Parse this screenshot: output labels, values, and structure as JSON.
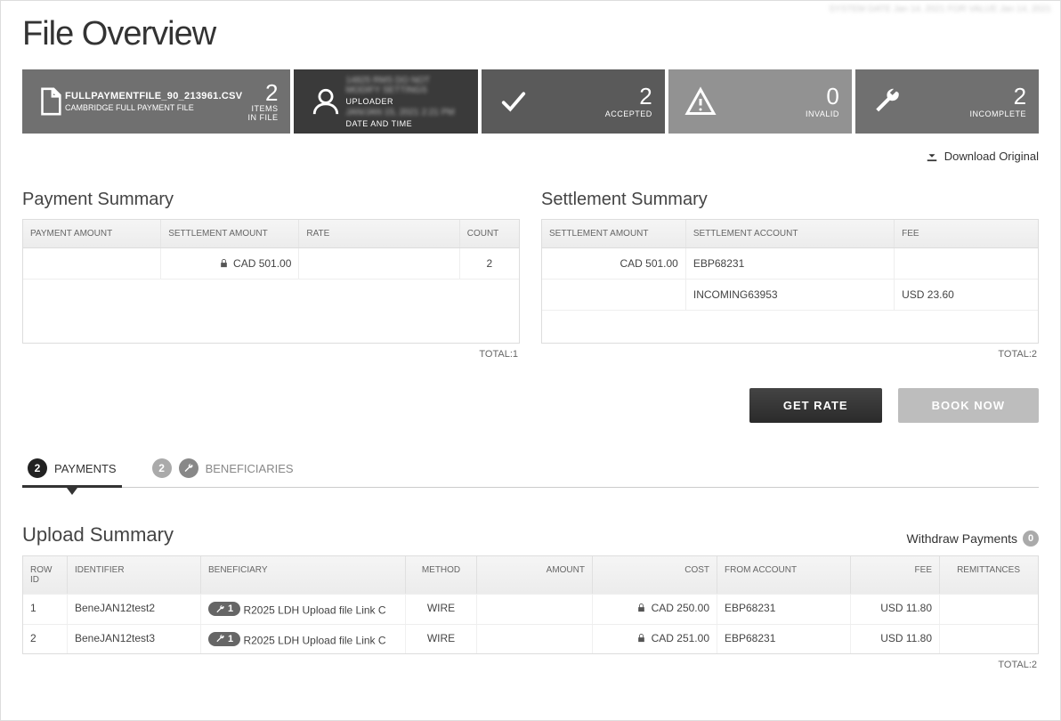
{
  "top_blur": "SYSTEM DATE Jan 14, 2021 FOR VALUE Jan 14, 2021",
  "title": "File Overview",
  "cards": {
    "file": {
      "name": "FULLPAYMENTFILE_90_213961.CSV",
      "desc": "CAMBRIDGE FULL PAYMENT FILE",
      "count": "2",
      "count_label": "ITEMS IN FILE"
    },
    "upload": {
      "line1_blur": "14825 RMS DO NOT MODIFY SETTINGS",
      "uploader_label": "UPLOADER",
      "line2_blur": "JAN/JAN 15, 2021 2:21 PM",
      "datetime_label": "DATE AND TIME"
    },
    "accepted": {
      "count": "2",
      "label": "ACCEPTED"
    },
    "invalid": {
      "count": "0",
      "label": "INVALID"
    },
    "incomplete": {
      "count": "2",
      "label": "INCOMPLETE"
    }
  },
  "download_label": "Download Original",
  "payment_summary": {
    "title": "Payment Summary",
    "headers": {
      "c1": "PAYMENT AMOUNT",
      "c2": "SETTLEMENT AMOUNT",
      "c3": "RATE",
      "c4": "COUNT"
    },
    "rows": [
      {
        "c1": "",
        "c2": "CAD 501.00",
        "c2_locked": true,
        "c3": "",
        "c4": "2"
      }
    ],
    "total_label": "TOTAL:1"
  },
  "settlement_summary": {
    "title": "Settlement Summary",
    "headers": {
      "c1": "SETTLEMENT AMOUNT",
      "c2": "SETTLEMENT ACCOUNT",
      "c3": "FEE"
    },
    "rows": [
      {
        "c1": "CAD 501.00",
        "c2": "EBP68231",
        "c3": ""
      },
      {
        "c1": "",
        "c2": "INCOMING63953",
        "c3": "USD 23.60"
      }
    ],
    "total_label": "TOTAL:2"
  },
  "buttons": {
    "get_rate": "GET RATE",
    "book_now": "BOOK NOW"
  },
  "tabs": {
    "payments": {
      "badge": "2",
      "label": "PAYMENTS"
    },
    "beneficiaries": {
      "badge": "2",
      "label": "BENEFICIARIES"
    }
  },
  "upload_summary": {
    "title": "Upload Summary",
    "withdraw_label": "Withdraw Payments",
    "withdraw_badge": "0",
    "headers": {
      "c1": "ROW ID",
      "c2": "IDENTIFIER",
      "c3": "BENEFICIARY",
      "c4": "METHOD",
      "c5": "AMOUNT",
      "c6": "COST",
      "c7": "FROM ACCOUNT",
      "c8": "FEE",
      "c9": "REMITTANCES"
    },
    "rows": [
      {
        "c1": "1",
        "c2": "BeneJAN12test2",
        "pill": "1",
        "c3": "R2025 LDH Upload file Link C",
        "c4": "WIRE",
        "c5": "",
        "c6": "CAD 250.00",
        "c6_locked": true,
        "c7": "EBP68231",
        "c8": "USD 11.80",
        "c9": ""
      },
      {
        "c1": "2",
        "c2": "BeneJAN12test3",
        "pill": "1",
        "c3": "R2025 LDH Upload file Link C",
        "c4": "WIRE",
        "c5": "",
        "c6": "CAD 251.00",
        "c6_locked": true,
        "c7": "EBP68231",
        "c8": "USD 11.80",
        "c9": ""
      }
    ],
    "total_label": "TOTAL:2"
  }
}
